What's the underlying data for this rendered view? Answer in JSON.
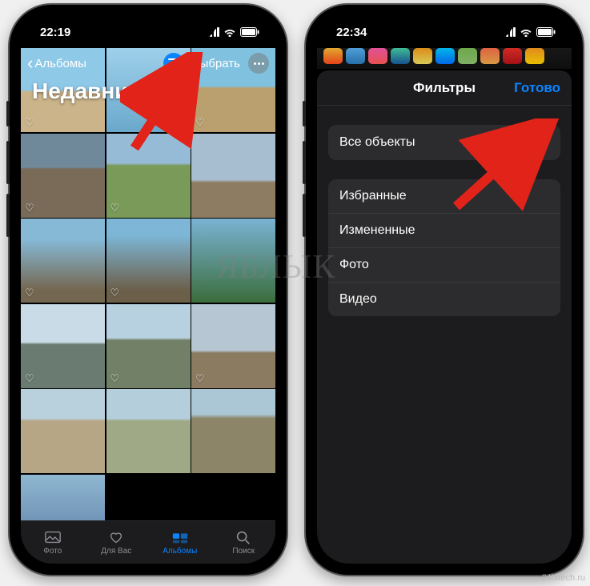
{
  "left": {
    "time": "22:19",
    "backLabel": "Альбомы",
    "selectLabel": "Выбрать",
    "title": "Недавние",
    "tabs": {
      "photo": "Фото",
      "forYou": "Для Вас",
      "albums": "Альбомы",
      "search": "Поиск"
    }
  },
  "right": {
    "time": "22:34",
    "modalTitle": "Фильтры",
    "done": "Готово",
    "rows": {
      "allItems": "Все объекты",
      "favorites": "Избранные",
      "edited": "Измененные",
      "photo": "Фото",
      "video": "Видео"
    },
    "checkmark": "✓"
  },
  "watermark": "ЯБЛЫК",
  "credit": "24hitech.ru"
}
